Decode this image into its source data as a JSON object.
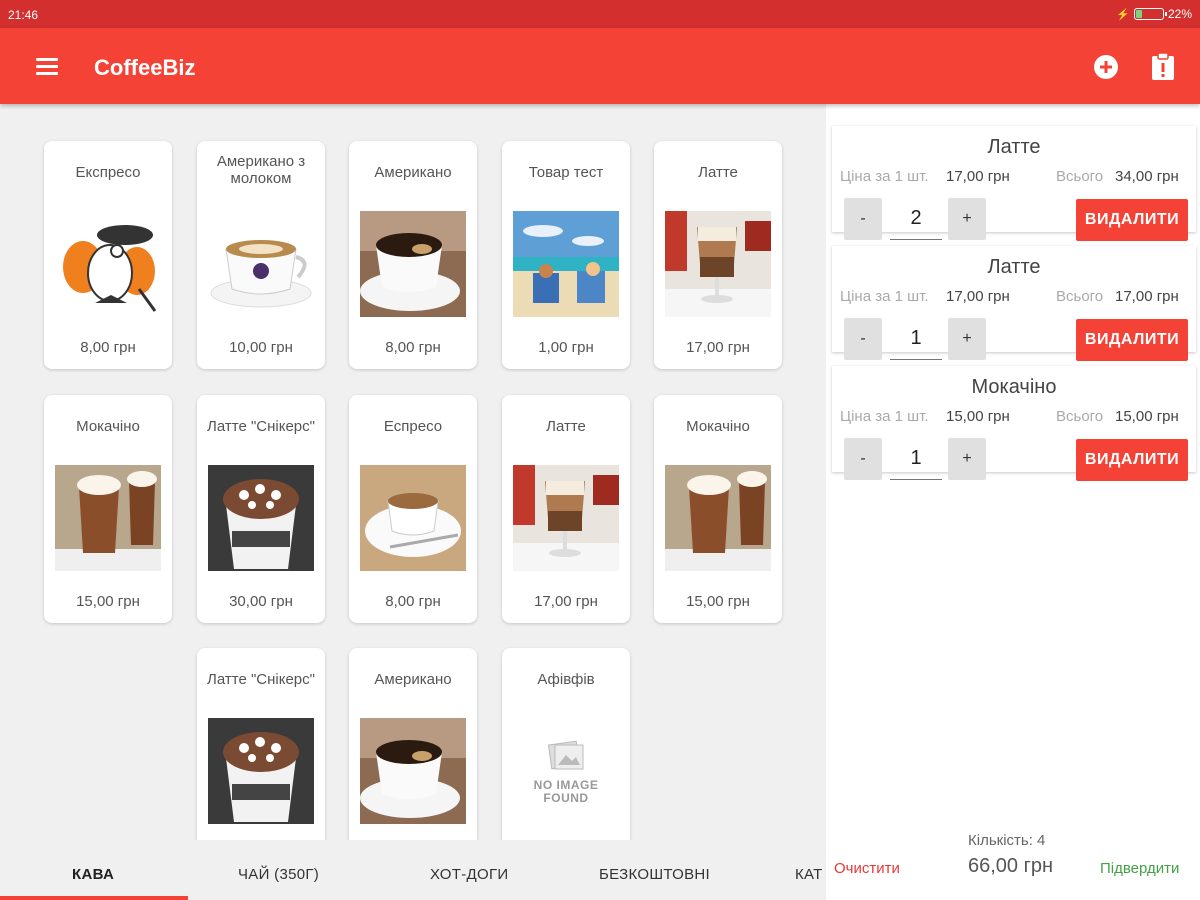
{
  "status_bar": {
    "time": "21:46",
    "battery": "22%",
    "battery_level": 0.22
  },
  "app_bar": {
    "title": "CoffeeBiz",
    "menu_icon": "menu-icon",
    "add_icon": "add-circle-icon",
    "orders_icon": "clipboard-alert-icon"
  },
  "colors": {
    "primary": "#f44336",
    "primary_dark": "#d32f2f",
    "clear": "#e53935",
    "confirm": "#43a047"
  },
  "products": [
    {
      "name": "Експресо",
      "price": "8,00 грн",
      "image": "bird-mascot"
    },
    {
      "name": "Американо з молоком",
      "price": "10,00 грн",
      "image": "latte-art-cup"
    },
    {
      "name": "Американо",
      "price": "8,00 грн",
      "image": "dark-coffee-cup"
    },
    {
      "name": "Товар тест",
      "price": "1,00 грн",
      "image": "beach"
    },
    {
      "name": "Латте",
      "price": "17,00 грн",
      "image": "latte-glass"
    },
    {
      "name": "Мокачіно",
      "price": "15,00 грн",
      "image": "mochaccino"
    },
    {
      "name": "Латте \"Снікерс\"",
      "price": "30,00 грн",
      "image": "snickers-cup"
    },
    {
      "name": "Еспресо",
      "price": "8,00 грн",
      "image": "espresso-cup"
    },
    {
      "name": "Латте",
      "price": "17,00 грн",
      "image": "latte-glass"
    },
    {
      "name": "Мокачіно",
      "price": "15,00 грн",
      "image": "mochaccino"
    },
    {
      "name": "Латте \"Снікерс\"",
      "price": "",
      "image": "snickers-cup"
    },
    {
      "name": "Американо",
      "price": "",
      "image": "dark-coffee-cup"
    },
    {
      "name": "Афівфів",
      "price": "",
      "image": "no-image",
      "no_image_text": [
        "NO IMAGE",
        "FOUND"
      ]
    }
  ],
  "tabs": [
    "КАВА",
    "ЧАЙ (350Г)",
    "ХОТ-ДОГИ",
    "БЕЗКОШТОВНІ",
    "КАТ"
  ],
  "active_tab": 0,
  "cart": {
    "unit_price_label": "Ціна за 1 шт.",
    "total_label": "Всього",
    "minus_label": "-",
    "plus_label": "+",
    "delete_label": "ВИДАЛИТИ",
    "items": [
      {
        "name": "Латте",
        "unit_price": "17,00 грн",
        "total": "34,00 грн",
        "qty": "2"
      },
      {
        "name": "Латте",
        "unit_price": "17,00 грн",
        "total": "17,00 грн",
        "qty": "1"
      },
      {
        "name": "Мокачіно",
        "unit_price": "15,00 грн",
        "total": "15,00 грн",
        "qty": "1"
      }
    ]
  },
  "footer": {
    "clear_label": "Очистити",
    "count_text": "Кількість: 4",
    "total": "66,00 грн",
    "confirm_label": "Підвердити"
  }
}
